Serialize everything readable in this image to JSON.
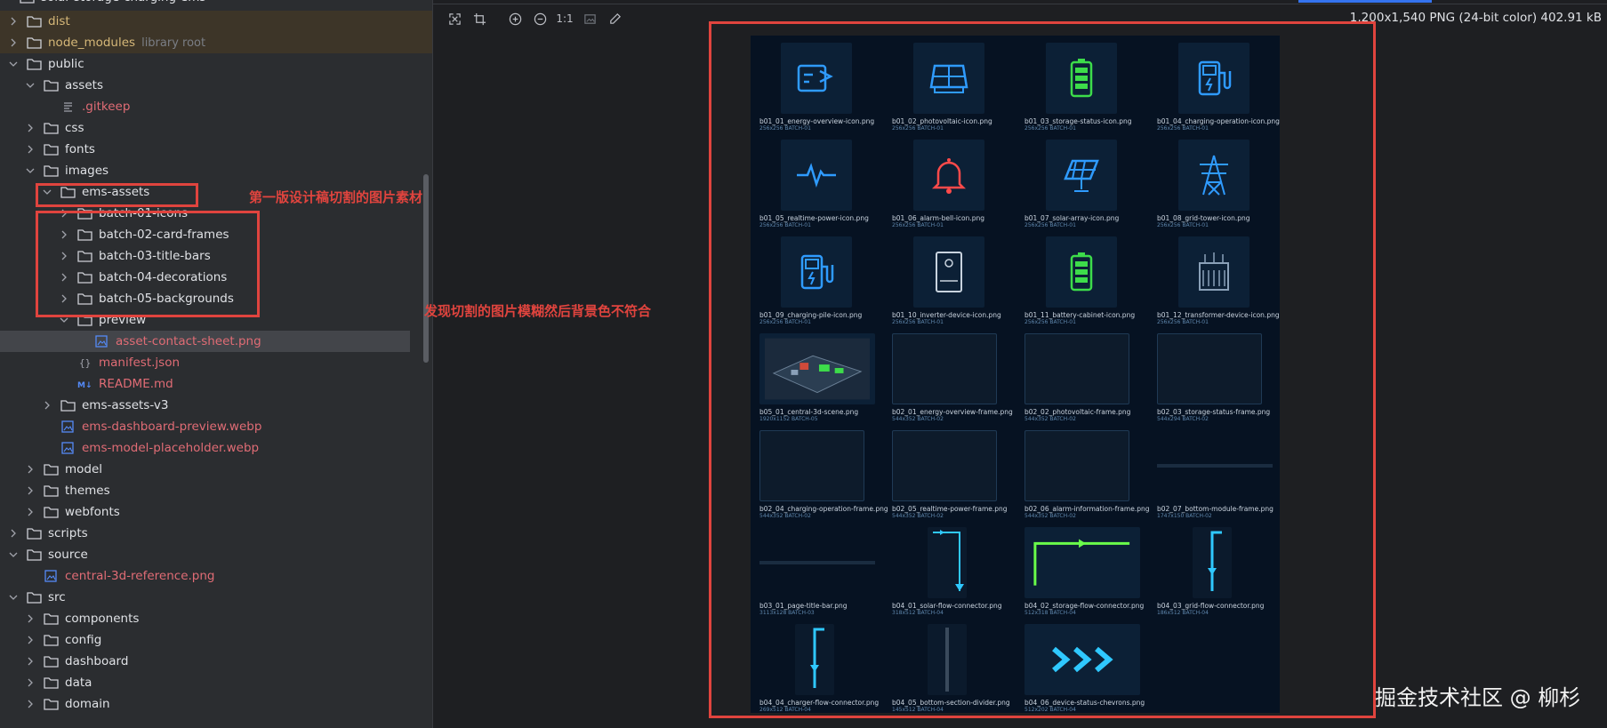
{
  "tree": {
    "cut_top_label": "solar-storage-charging-ems",
    "rows": [
      {
        "label": "dist",
        "type": "folder",
        "level": 0,
        "open": false,
        "style": "orange",
        "excluded": true
      },
      {
        "label": "node_modules",
        "type": "folder",
        "level": 0,
        "open": false,
        "style": "orange",
        "excluded": true,
        "suffix": "library root"
      },
      {
        "label": "public",
        "type": "folder",
        "level": 0,
        "open": true
      },
      {
        "label": "assets",
        "type": "folder",
        "level": 1,
        "open": true
      },
      {
        "label": ".gitkeep",
        "type": "text-file",
        "level": 2,
        "style": "red"
      },
      {
        "label": "css",
        "type": "folder",
        "level": 1,
        "open": false
      },
      {
        "label": "fonts",
        "type": "folder",
        "level": 1,
        "open": false
      },
      {
        "label": "images",
        "type": "folder",
        "level": 1,
        "open": true
      },
      {
        "label": "ems-assets",
        "type": "folder",
        "level": 2,
        "open": true
      },
      {
        "label": "batch-01-icons",
        "type": "folder",
        "level": 3,
        "open": false
      },
      {
        "label": "batch-02-card-frames",
        "type": "folder",
        "level": 3,
        "open": false
      },
      {
        "label": "batch-03-title-bars",
        "type": "folder",
        "level": 3,
        "open": false
      },
      {
        "label": "batch-04-decorations",
        "type": "folder",
        "level": 3,
        "open": false
      },
      {
        "label": "batch-05-backgrounds",
        "type": "folder",
        "level": 3,
        "open": false
      },
      {
        "label": "preview",
        "type": "folder",
        "level": 3,
        "open": true
      },
      {
        "label": "asset-contact-sheet.png",
        "type": "image-file",
        "level": 4,
        "style": "red",
        "selected": true
      },
      {
        "label": "manifest.json",
        "type": "json-file",
        "level": 3,
        "style": "red"
      },
      {
        "label": "README.md",
        "type": "md-file",
        "level": 3,
        "style": "red"
      },
      {
        "label": "ems-assets-v3",
        "type": "folder",
        "level": 2,
        "open": false
      },
      {
        "label": "ems-dashboard-preview.webp",
        "type": "image-file",
        "level": 2,
        "style": "red"
      },
      {
        "label": "ems-model-placeholder.webp",
        "type": "image-file",
        "level": 2,
        "style": "red"
      },
      {
        "label": "model",
        "type": "folder",
        "level": 1,
        "open": false
      },
      {
        "label": "themes",
        "type": "folder",
        "level": 1,
        "open": false
      },
      {
        "label": "webfonts",
        "type": "folder",
        "level": 1,
        "open": false
      },
      {
        "label": "scripts",
        "type": "folder",
        "level": 0,
        "open": false
      },
      {
        "label": "source",
        "type": "folder",
        "level": 0,
        "open": true
      },
      {
        "label": "central-3d-reference.png",
        "type": "image-file",
        "level": 1,
        "style": "red"
      },
      {
        "label": "src",
        "type": "folder",
        "level": 0,
        "open": true
      },
      {
        "label": "components",
        "type": "folder",
        "level": 1,
        "open": false
      },
      {
        "label": "config",
        "type": "folder",
        "level": 1,
        "open": false
      },
      {
        "label": "dashboard",
        "type": "folder",
        "level": 1,
        "open": false
      },
      {
        "label": "data",
        "type": "folder",
        "level": 1,
        "open": false
      },
      {
        "label": "domain",
        "type": "folder",
        "level": 1,
        "open": false
      }
    ]
  },
  "viewer": {
    "zoom_label": "1:1",
    "image_info": "1,200x1,540 PNG (24-bit color) 402.91 kB",
    "toolbar_icons": [
      "fit-screen-icon",
      "crop-icon",
      "zoom-in-icon",
      "zoom-out-icon",
      "actual-size-icon",
      "background-icon",
      "color-picker-icon"
    ]
  },
  "sheet": {
    "items": [
      {
        "name": "b01_01_energy-overview-icon.png",
        "meta": "256x256  BATCH-01",
        "icon": "chart-icon",
        "color": "#2f9bff",
        "kind": "icon"
      },
      {
        "name": "b01_02_photovoltaic-icon.png",
        "meta": "256x256  BATCH-01",
        "icon": "solar-panel-icon",
        "color": "#2f9bff",
        "kind": "icon"
      },
      {
        "name": "b01_03_storage-status-icon.png",
        "meta": "256x256  BATCH-01",
        "icon": "battery-icon",
        "color": "#3ddc4a",
        "kind": "icon"
      },
      {
        "name": "b01_04_charging-operation-icon.png",
        "meta": "256x256  BATCH-01",
        "icon": "charger-icon",
        "color": "#2f9bff",
        "kind": "icon"
      },
      {
        "name": "b01_05_realtime-power-icon.png",
        "meta": "256x256  BATCH-01",
        "icon": "pulse-icon",
        "color": "#2f9bff",
        "kind": "icon"
      },
      {
        "name": "b01_06_alarm-bell-icon.png",
        "meta": "256x256  BATCH-01",
        "icon": "bell-icon",
        "color": "#ff4a4a",
        "kind": "icon"
      },
      {
        "name": "b01_07_solar-array-icon.png",
        "meta": "256x256  BATCH-01",
        "icon": "solar-array-icon",
        "color": "#2f9bff",
        "kind": "icon"
      },
      {
        "name": "b01_08_grid-tower-icon.png",
        "meta": "256x256  BATCH-01",
        "icon": "tower-icon",
        "color": "#2f9bff",
        "kind": "icon"
      },
      {
        "name": "b01_09_charging-pile-icon.png",
        "meta": "256x256  BATCH-01",
        "icon": "charger-icon",
        "color": "#2f9bff",
        "kind": "icon"
      },
      {
        "name": "b01_10_inverter-device-icon.png",
        "meta": "256x256  BATCH-01",
        "icon": "inverter-icon",
        "color": "#c9d3de",
        "kind": "icon"
      },
      {
        "name": "b01_11_battery-cabinet-icon.png",
        "meta": "256x256  BATCH-01",
        "icon": "battery-icon",
        "color": "#3ddc4a",
        "kind": "icon"
      },
      {
        "name": "b01_12_transformer-device-icon.png",
        "meta": "256x256  BATCH-01",
        "icon": "transformer-icon",
        "color": "#8aa0b8",
        "kind": "icon"
      },
      {
        "name": "b05_01_central-3d-scene.png",
        "meta": "1920x1152  BATCH-05",
        "icon": "scene-icon",
        "color": "#3ddc4a",
        "kind": "scene"
      },
      {
        "name": "b02_01_energy-overview-frame.png",
        "meta": "544x352  BATCH-02",
        "icon": "frame-icon",
        "color": "#1f3a55",
        "kind": "frame"
      },
      {
        "name": "b02_02_photovoltaic-frame.png",
        "meta": "544x352  BATCH-02",
        "icon": "frame-icon",
        "color": "#1f3a55",
        "kind": "frame"
      },
      {
        "name": "b02_03_storage-status-frame.png",
        "meta": "544x294  BATCH-02",
        "icon": "frame-icon",
        "color": "#1f3a55",
        "kind": "frame"
      },
      {
        "name": "b02_04_charging-operation-frame.png",
        "meta": "544x352  BATCH-02",
        "icon": "frame-icon",
        "color": "#1f3a55",
        "kind": "frame"
      },
      {
        "name": "b02_05_realtime-power-frame.png",
        "meta": "544x352  BATCH-02",
        "icon": "frame-icon",
        "color": "#1f3a55",
        "kind": "frame"
      },
      {
        "name": "b02_06_alarm-information-frame.png",
        "meta": "544x352  BATCH-02",
        "icon": "frame-icon",
        "color": "#1f3a55",
        "kind": "frame"
      },
      {
        "name": "b02_07_bottom-module-frame.png",
        "meta": "1747x150  BATCH-02",
        "icon": "bar-icon",
        "color": "#1f3a55",
        "kind": "bar"
      },
      {
        "name": "b03_01_page-title-bar.png",
        "meta": "3113x128  BATCH-03",
        "icon": "bar-icon",
        "color": "#1f3a55",
        "kind": "bar"
      },
      {
        "name": "b04_01_solar-flow-connector.png",
        "meta": "318x512  BATCH-04",
        "icon": "connector-icon",
        "color": "#2fc8ff",
        "kind": "connector-down"
      },
      {
        "name": "b04_02_storage-flow-connector.png",
        "meta": "512x318  BATCH-04",
        "icon": "connector-icon",
        "color": "#6aff4a",
        "kind": "connector-right"
      },
      {
        "name": "b04_03_grid-flow-connector.png",
        "meta": "186x512  BATCH-04",
        "icon": "connector-icon",
        "color": "#2fc8ff",
        "kind": "connector-vert"
      },
      {
        "name": "b04_04_charger-flow-connector.png",
        "meta": "269x512  BATCH-04",
        "icon": "connector-icon",
        "color": "#2fc8ff",
        "kind": "connector-vert"
      },
      {
        "name": "b04_05_bottom-section-divider.png",
        "meta": "145x512  BATCH-04",
        "icon": "divider-icon",
        "color": "#3a4a5c",
        "kind": "divider"
      },
      {
        "name": "b04_06_device-status-chevrons.png",
        "meta": "512x202  BATCH-04",
        "icon": "chevrons-icon",
        "color": "#2fc8ff",
        "kind": "chevrons"
      }
    ]
  },
  "annotations": {
    "note1": "第一版设计稿切割的图片素材",
    "note2": "发现切割的图片模糊然后背景色不符合",
    "accent": "#e0443e"
  },
  "watermark": "掘金技术社区 @ 柳杉"
}
